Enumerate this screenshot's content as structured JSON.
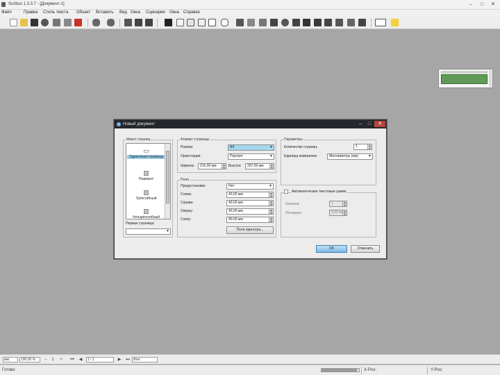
{
  "window": {
    "title": "Scribus 1.3.3.7 - [Документ-1]",
    "min": "–",
    "max": "□",
    "close": "✕"
  },
  "menu": [
    "Файл",
    "Правка",
    "Стиль текста",
    "Объект",
    "Вставить",
    "Вид",
    "Окна",
    "Сценарии",
    "Окна",
    "Справка"
  ],
  "toolbar_icons": [
    "new-icon",
    "open-icon",
    "save-icon",
    "close-doc-icon",
    "print-icon",
    "preflight-icon",
    "pdf-icon",
    "undo-icon",
    "redo-icon",
    "cut-icon",
    "copy-icon",
    "paste-icon",
    "select-icon",
    "text-frame-icon",
    "image-frame-icon",
    "render-frame-icon",
    "table-icon",
    "shape-icon",
    "polygon-icon",
    "line-icon",
    "bezier-icon",
    "freehand-icon",
    "rotate-icon",
    "zoom-icon",
    "edit-content-icon",
    "edit-text-icon",
    "link-frames-icon",
    "unlink-frames-icon",
    "measure-icon",
    "copy-properties-icon",
    "eyedropper-icon",
    "pdf-tools-icon",
    "pdf-annotations-icon"
  ],
  "dialog": {
    "title": "Новый документ",
    "layout_group": {
      "title": "Макет страниц",
      "items": [
        {
          "label": "Одиночная страница",
          "glyph": "▭"
        },
        {
          "label": "Разворот",
          "glyph": "▥"
        },
        {
          "label": "Трёхсгибный",
          "glyph": "▥"
        },
        {
          "label": "Четырёхсгибный",
          "glyph": "▥"
        }
      ],
      "first_page_label": "Первая страница:",
      "first_page_value": ""
    },
    "page_size_group": {
      "title": "Формат страницы",
      "size_label": "Размер:",
      "size_value": "A4",
      "orientation_label": "Ориентация:",
      "orientation_value": "Портрет",
      "width_label": "Ширина:",
      "width_value": "210,00 мм",
      "height_label": "Высота:",
      "height_value": "297,00 мм"
    },
    "margins_group": {
      "title": "Поля",
      "preset_label": "Предустановки:",
      "preset_value": "Нет",
      "left_label": "Слева:",
      "left_value": "40,00 мм",
      "right_label": "Справа:",
      "right_value": "40,00 мм",
      "top_label": "Сверху:",
      "top_value": "40,00 мм",
      "bottom_label": "Снизу:",
      "bottom_value": "40,00 мм",
      "printer_margins_button": "Поля принтера..."
    },
    "options_group": {
      "title": "Параметры",
      "pages_label": "Количество страниц:",
      "pages_value": "1",
      "units_label": "Единица измерения:",
      "units_value": "Миллиметры (мм)"
    },
    "columns_group": {
      "checkbox_label": "Автоматические текстовые рамки",
      "columns_label": "Колонок:",
      "columns_value": "1",
      "gap_label": "Интервал:",
      "gap_value": "3,90 мм"
    },
    "ok_label": "OK",
    "cancel_label": "Отменить"
  },
  "nav_bar": {
    "units": "мм",
    "zoom": "100,00 %",
    "page": "1 / 1",
    "layer": "Фон"
  },
  "status": {
    "text": "Готово",
    "progress": 0.95,
    "x_label": "X-Pos:",
    "y_label": "Y-Pos:"
  },
  "colors": {
    "workspace": "#a6a6a6",
    "dialog_title_bg": "#24272b",
    "selection": "#a5d7ef",
    "bird_view_page": "#5f9a56"
  }
}
